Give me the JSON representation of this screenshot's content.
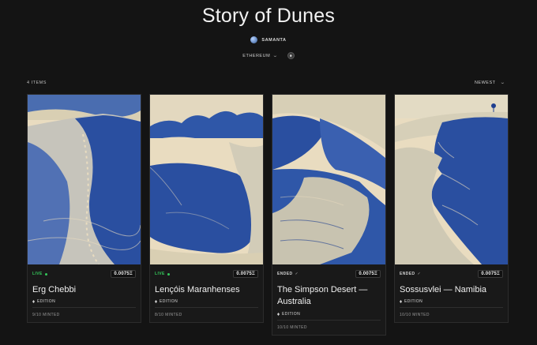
{
  "page": {
    "title": "Story of Dunes",
    "creator": "SAMANTA",
    "chain": "ETHEREUM",
    "item_count": "4 ITEMS",
    "sort": "NEWEST"
  },
  "icons": {
    "avatar": "avatar",
    "chain_chevron": "chevron-down-icon",
    "chain_logo": "ethereum-icon",
    "sort_chevron": "chevron-down-icon",
    "edition": "edition-icon"
  },
  "colors": {
    "background": "#141414",
    "live": "#33c75a",
    "art_paper": "#e9dcc0",
    "art_ink": "#1f3f8f"
  },
  "cards": [
    {
      "status": "LIVE",
      "price": "0.0075Ξ",
      "name": "Erg Chebbi",
      "edition": "EDITION",
      "minted": "9/10 MINTED"
    },
    {
      "status": "LIVE",
      "price": "0.0075Ξ",
      "name": "Lençóis Maranhenses",
      "edition": "EDITION",
      "minted": "8/10 MINTED"
    },
    {
      "status": "ENDED",
      "price": "0.0075Ξ",
      "name": "The Simpson Desert — Australia",
      "edition": "EDITION",
      "minted": "10/10 MINTED"
    },
    {
      "status": "ENDED",
      "price": "0.0075Ξ",
      "name": "Sossusvlei — Namibia",
      "edition": "EDITION",
      "minted": "10/10 MINTED"
    }
  ]
}
